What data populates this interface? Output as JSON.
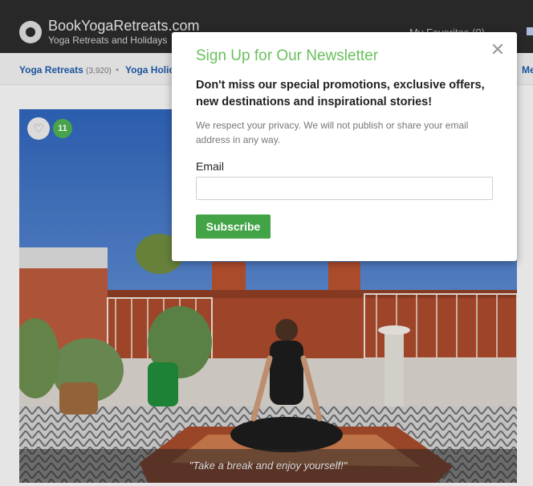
{
  "header": {
    "site_name": "BookYogaRetreats.com",
    "tagline": "Yoga Retreats and Holidays",
    "favorites_label": "My Favorites (0)"
  },
  "breadcrumb": {
    "items": [
      {
        "label": "Yoga Retreats",
        "count": "(3,920)"
      },
      {
        "label": "Yoga Holid"
      },
      {
        "label": "Me"
      }
    ]
  },
  "hero": {
    "favorite_count": "11",
    "caption": "\"Take a break and enjoy yourself!\""
  },
  "newsletter_modal": {
    "title": "Sign Up for Our Newsletter",
    "lead": "Don't miss our special promotions, exclusive offers, new destinations and inspirational stories!",
    "privacy_note": "We respect your privacy. We will not publish or share your email address in any way.",
    "email_label": "Email",
    "email_value": "",
    "subscribe_label": "Subscribe",
    "close_glyph": "✕"
  },
  "icons": {
    "logo": "logo-icon",
    "favorite": "heart-icon",
    "close": "close-icon"
  },
  "colors": {
    "accent_green": "#43a447",
    "title_green": "#6abf5d",
    "link_blue": "#1e5aa8",
    "header_bg": "#2b2b2b"
  }
}
